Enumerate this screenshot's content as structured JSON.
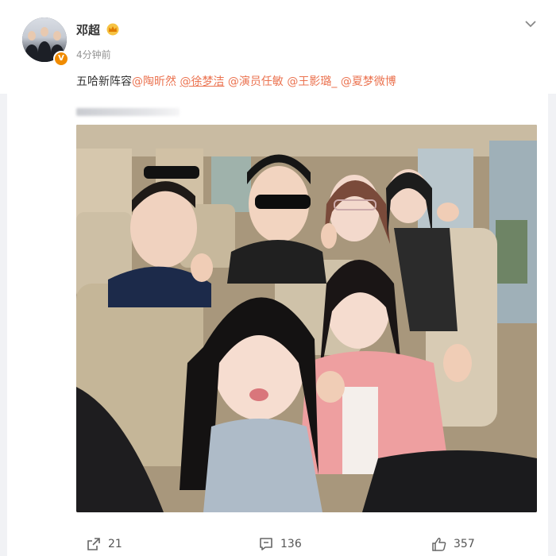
{
  "post": {
    "username": "邓超",
    "verified_badge": "V",
    "crown_icon": "crown-icon",
    "timestamp": "4分钟前",
    "text_prefix": "五哈新阵容",
    "mentions": [
      "@陶昕然",
      "@徐梦洁",
      "@演员任敏",
      "@王影璐_",
      "@夏梦微博"
    ]
  },
  "footer": {
    "repost_count": "21",
    "comment_count": "136",
    "like_count": "357"
  },
  "colors": {
    "mention": "#eb7350",
    "verified": "#f08b00",
    "text": "#333333",
    "muted": "#939393"
  },
  "photo": {
    "description_icon": "group-selfie-photo"
  }
}
